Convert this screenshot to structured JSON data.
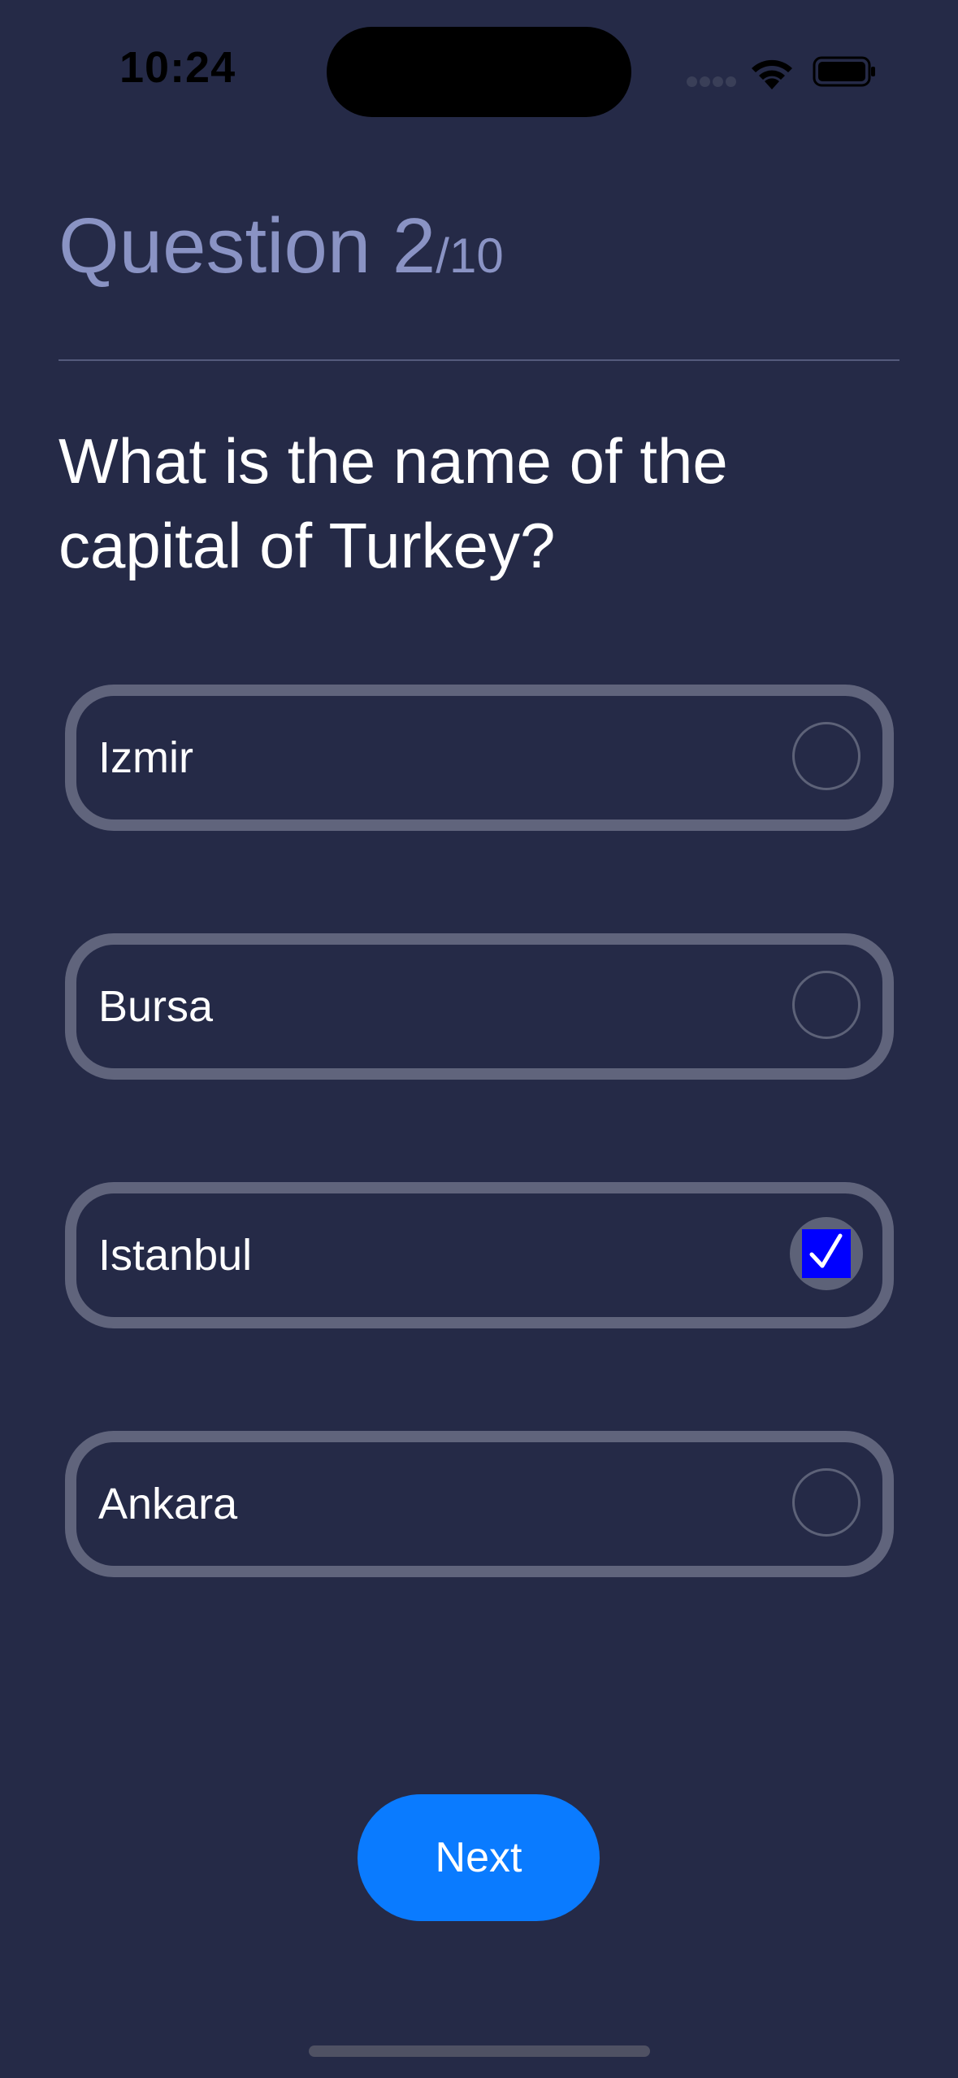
{
  "status_bar": {
    "time": "10:24"
  },
  "header": {
    "title_prefix": "Question 2",
    "title_total": "/10"
  },
  "question": {
    "text": "What is the name of the capital of Turkey?"
  },
  "options": [
    {
      "label": "Izmir",
      "selected": false
    },
    {
      "label": "Bursa",
      "selected": false
    },
    {
      "label": "Istanbul",
      "selected": true
    },
    {
      "label": "Ankara",
      "selected": false
    }
  ],
  "actions": {
    "next_label": "Next"
  },
  "colors": {
    "background": "#252a47",
    "title": "#8a93c4",
    "option_border": "#60647c",
    "next_button": "#0a7bff",
    "checkbox_fill": "#0000ff"
  },
  "icons": {
    "status": [
      "cellular-signal-icon",
      "wifi-icon",
      "battery-icon"
    ],
    "option_unchecked": "radio-circle-icon",
    "option_checked": "checkbox-checked-icon"
  }
}
